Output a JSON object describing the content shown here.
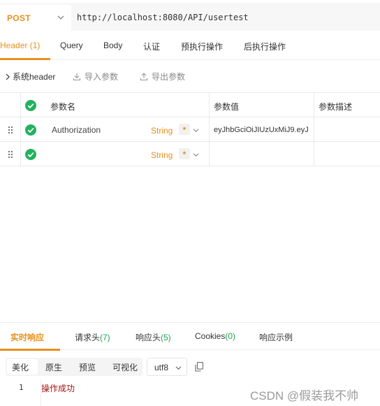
{
  "request": {
    "method": "POST",
    "url": "http://localhost:8080/API/usertest"
  },
  "tabs": [
    {
      "label": "Header (1)",
      "active": true
    },
    {
      "label": "Query"
    },
    {
      "label": "Body"
    },
    {
      "label": "认证"
    },
    {
      "label": "预执行操作"
    },
    {
      "label": "后执行操作"
    }
  ],
  "toolbar": {
    "system_header": "系统header",
    "import": "导入参数",
    "export": "导出参数"
  },
  "table": {
    "columns": [
      "参数名",
      "参数值",
      "参数描述"
    ],
    "rows": [
      {
        "name": "Authorization",
        "type": "String",
        "required": "*",
        "value": "eyJhbGciOiJIUzUxMiJ9.eyJ",
        "description": ""
      },
      {
        "name": "",
        "type": "String",
        "required": "*",
        "value": "",
        "description": ""
      }
    ]
  },
  "response": {
    "tabs": [
      {
        "label": "实时响应",
        "count": "",
        "active": true
      },
      {
        "label": "请求头",
        "count": "(7)"
      },
      {
        "label": "响应头",
        "count": "(5)"
      },
      {
        "label": "Cookies",
        "count": "(0)"
      },
      {
        "label": "响应示例",
        "count": ""
      }
    ],
    "view_modes": [
      "美化",
      "原生",
      "预览",
      "可视化"
    ],
    "active_view": "美化",
    "encoding": "utf8",
    "lines": [
      {
        "number": "1",
        "text": "操作成功"
      }
    ]
  },
  "watermark": "CSDN @假装我不帅",
  "colors": {
    "accent": "#e8901c",
    "check": "#22b25f",
    "count": "#22a050",
    "code_text": "#a31515"
  }
}
